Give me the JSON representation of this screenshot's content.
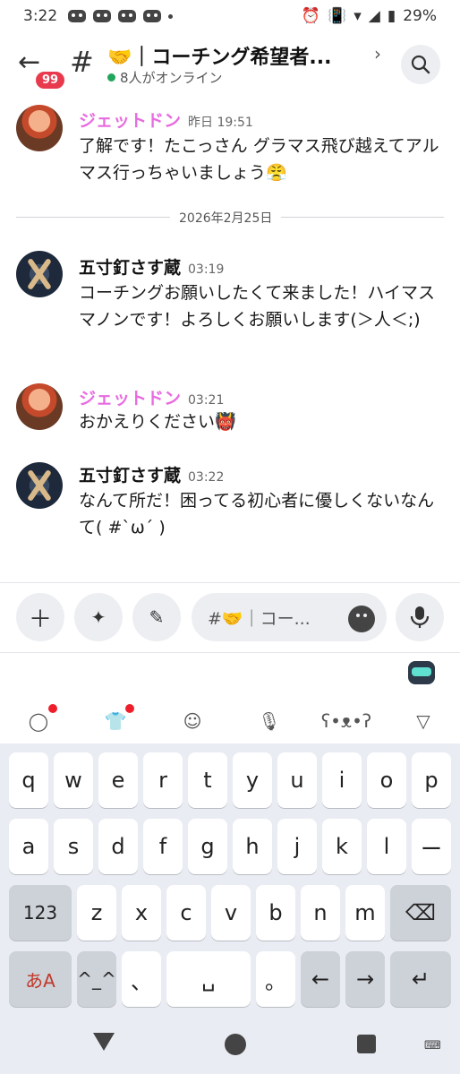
{
  "status": {
    "time": "3:22",
    "battery": "29%"
  },
  "header": {
    "unread_badge": "99",
    "channel_title": "🤝｜コーチング希望者...",
    "online_text": "8人がオンライン"
  },
  "messages": [
    {
      "author": "ジェットドン",
      "timestamp": "昨日 19:51",
      "body": "了解です！たこっさん グラマス飛び越えてアルマス行っちゃいましょう😤",
      "color": "#e86be0"
    },
    {
      "author": "五寸釘さす蔵",
      "timestamp": "03:19",
      "body": "コーチングお願いしたくて来ました！ハイマスマノンです！よろしくお願いします(＞人＜;)",
      "color": "#111111"
    },
    {
      "author": "ジェットドン",
      "timestamp": "03:21",
      "body": "おかえりください👹",
      "color": "#e86be0"
    },
    {
      "author": "五寸釘さす蔵",
      "timestamp": "03:22",
      "body": "なんて所だ！困ってる初心者に優しくないなんて( #`ω´ )",
      "color": "#111111"
    }
  ],
  "date_divider": "2026年2月25日",
  "composer": {
    "placeholder": "#🤝｜コー..."
  },
  "keyboard": {
    "row1": [
      "q",
      "w",
      "e",
      "r",
      "t",
      "y",
      "u",
      "i",
      "o",
      "p"
    ],
    "row2": [
      "a",
      "s",
      "d",
      "f",
      "g",
      "h",
      "j",
      "k",
      "l",
      "ー"
    ],
    "row3": [
      "123",
      "z",
      "x",
      "c",
      "v",
      "b",
      "n",
      "m",
      "⌫"
    ],
    "row4": [
      "あA",
      "^_^",
      "、",
      "␣",
      "。",
      "←",
      "→",
      "↵"
    ]
  }
}
